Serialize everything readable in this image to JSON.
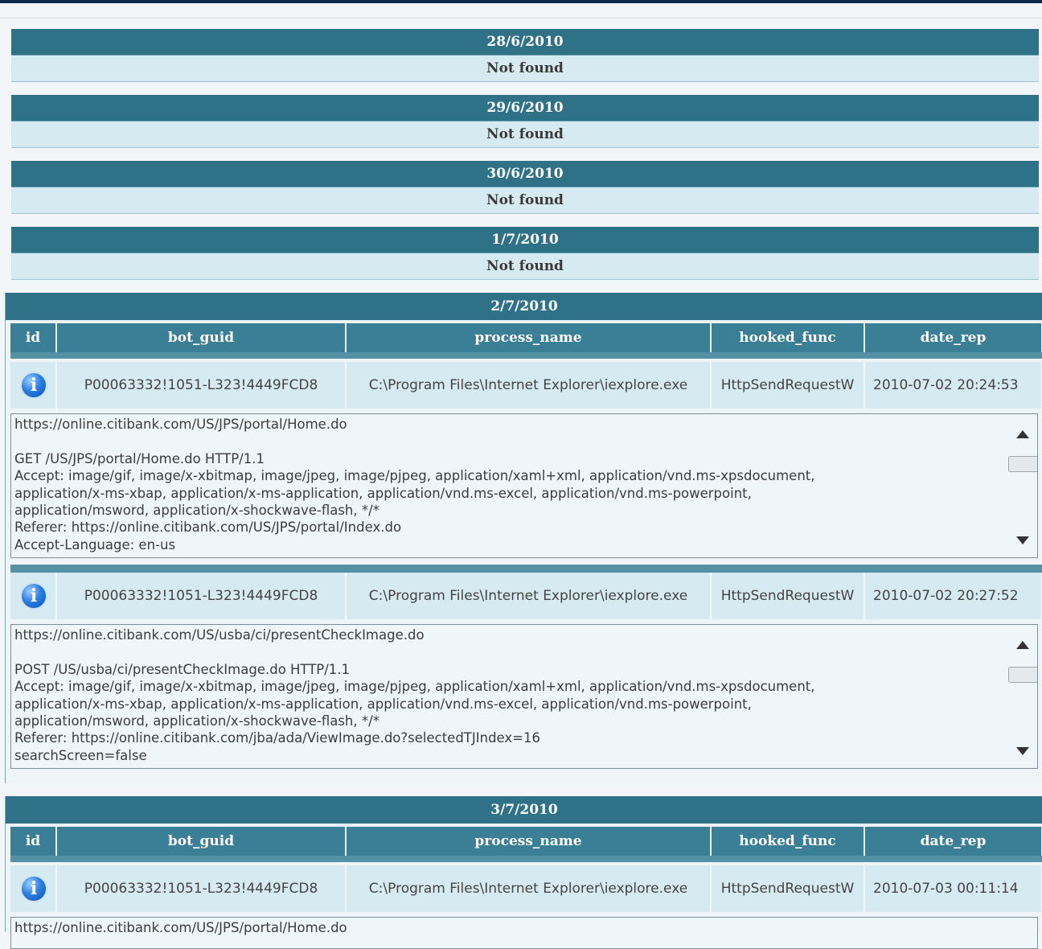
{
  "empty_days": [
    {
      "date": "28/6/2010",
      "status": "Not found"
    },
    {
      "date": "29/6/2010",
      "status": "Not found"
    },
    {
      "date": "30/6/2010",
      "status": "Not found"
    },
    {
      "date": "1/7/2010",
      "status": "Not found"
    }
  ],
  "columns": {
    "id": "id",
    "bot_guid": "bot_guid",
    "process_name": "process_name",
    "hooked_func": "hooked_func",
    "date_rep": "date_rep"
  },
  "sections": [
    {
      "date": "2/7/2010",
      "records": [
        {
          "bot_guid": "P00063332!1051-L323!4449FCD8",
          "process_name": "C:\\Program Files\\Internet Explorer\\iexplore.exe",
          "hooked_func": "HttpSendRequestW",
          "date_rep": "2010-07-02 20:24:53",
          "request": "https://online.citibank.com/US/JPS/portal/Home.do\n\nGET /US/JPS/portal/Home.do HTTP/1.1\nAccept: image/gif, image/x-xbitmap, image/jpeg, image/pjpeg, application/xaml+xml, application/vnd.ms-xpsdocument,\napplication/x-ms-xbap, application/x-ms-application, application/vnd.ms-excel, application/vnd.ms-powerpoint,\napplication/msword, application/x-shockwave-flash, */*\nReferer: https://online.citibank.com/US/JPS/portal/Index.do\nAccept-Language: en-us"
        },
        {
          "bot_guid": "P00063332!1051-L323!4449FCD8",
          "process_name": "C:\\Program Files\\Internet Explorer\\iexplore.exe",
          "hooked_func": "HttpSendRequestW",
          "date_rep": "2010-07-02 20:27:52",
          "request": "https://online.citibank.com/US/usba/ci/presentCheckImage.do\n\nPOST /US/usba/ci/presentCheckImage.do HTTP/1.1\nAccept: image/gif, image/x-xbitmap, image/jpeg, image/pjpeg, application/xaml+xml, application/vnd.ms-xpsdocument,\napplication/x-ms-xbap, application/x-ms-application, application/vnd.ms-excel, application/vnd.ms-powerpoint,\napplication/msword, application/x-shockwave-flash, */*\nReferer: https://online.citibank.com/jba/ada/ViewImage.do?selectedTJIndex=16\nsearchScreen=false"
        }
      ]
    },
    {
      "date": "3/7/2010",
      "records": [
        {
          "bot_guid": "P00063332!1051-L323!4449FCD8",
          "process_name": "C:\\Program Files\\Internet Explorer\\iexplore.exe",
          "hooked_func": "HttpSendRequestW",
          "date_rep": "2010-07-03 00:11:14",
          "request": "https://online.citibank.com/US/JPS/portal/Home.do"
        }
      ]
    }
  ],
  "icons": {
    "info": "info-icon",
    "scroll_up": "scroll-up-arrow-icon",
    "scroll_down": "scroll-down-arrow-icon"
  },
  "colors": {
    "header": "#2f7288",
    "row": "#d6eaf2",
    "page": "#f2f6f8"
  }
}
